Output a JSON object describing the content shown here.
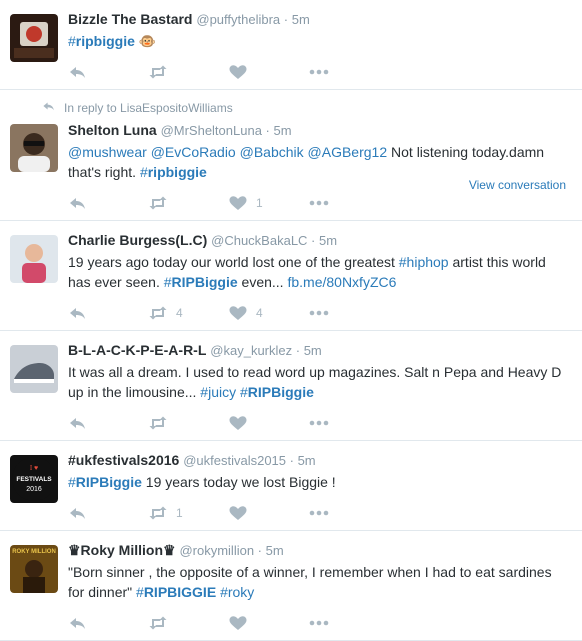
{
  "tweets": [
    {
      "name": "Bizzle The Bastard",
      "handle": "@puffythelibra",
      "time": "5m",
      "segments": [
        {
          "type": "hashtag",
          "hash": "#",
          "tag": "ripbiggie"
        },
        {
          "type": "text",
          "text": " 🐵"
        }
      ],
      "retweets": "",
      "likes": "",
      "avatar": {
        "bg": "#2b1a12",
        "accent": "#c0392b"
      }
    },
    {
      "reply_context": "In reply to LisaEspositoWilliams",
      "name": "Shelton Luna",
      "handle": "@MrSheltonLuna",
      "time": "5m",
      "segments": [
        {
          "type": "link",
          "text": "@mushwear"
        },
        {
          "type": "text",
          "text": " "
        },
        {
          "type": "link",
          "text": "@EvCoRadio"
        },
        {
          "type": "text",
          "text": " "
        },
        {
          "type": "link",
          "text": "@Babchik"
        },
        {
          "type": "text",
          "text": " "
        },
        {
          "type": "link",
          "text": "@AGBerg12"
        },
        {
          "type": "text",
          "text": " Not listening today.damn that's right.  "
        },
        {
          "type": "hashtag",
          "hash": "#",
          "tag": "ripbiggie"
        }
      ],
      "retweets": "",
      "likes": "1",
      "view_conversation": "View conversation",
      "avatar": {
        "bg": "#8a7560",
        "accent": "#3a2a1e"
      }
    },
    {
      "name": "Charlie Burgess(L.C)",
      "handle": "@ChuckBakaLC",
      "time": "5m",
      "segments": [
        {
          "type": "text",
          "text": "19 years ago today our world lost one of the greatest "
        },
        {
          "type": "link",
          "text": "#hiphop"
        },
        {
          "type": "text",
          "text": " artist this world has ever seen.  "
        },
        {
          "type": "hashtag",
          "hash": "#",
          "tag": "RIPBiggie"
        },
        {
          "type": "text",
          "text": " even... "
        },
        {
          "type": "link",
          "text": "fb.me/80NxfyZC6"
        }
      ],
      "retweets": "4",
      "likes": "4",
      "avatar": {
        "bg": "#dfe6ec",
        "accent": "#d24a6a"
      }
    },
    {
      "name": "B-L-A-C-K-P-E-A-R-L",
      "handle": "@kay_kurklez",
      "time": "5m",
      "segments": [
        {
          "type": "text",
          "text": "It was all a dream. I used to read word up magazines. Salt n Pepa and Heavy D up in the limousine... "
        },
        {
          "type": "link",
          "text": "#juicy"
        },
        {
          "type": "text",
          "text": " "
        },
        {
          "type": "hashtag",
          "hash": "#",
          "tag": "RIPBiggie"
        }
      ],
      "retweets": "",
      "likes": "",
      "avatar": {
        "bg": "#c9cfd6",
        "accent": "#5b6470"
      }
    },
    {
      "name": "#ukfestivals2016",
      "handle": "@ukfestivals2015",
      "time": "5m",
      "segments": [
        {
          "type": "hashtag",
          "hash": "#",
          "tag": "RIPBiggie"
        },
        {
          "type": "text",
          "text": " 19 years today we lost Biggie  !"
        }
      ],
      "retweets": "1",
      "likes": "",
      "avatar": {
        "bg": "#111111",
        "accent": "#ffffff",
        "line1": "I ♥",
        "line2": "FESTIVALS",
        "line3": "2016"
      }
    },
    {
      "name": "♛Roky Million♛",
      "handle": "@rokymillion",
      "time": "5m",
      "segments": [
        {
          "type": "text",
          "text": "\"Born sinner , the opposite of a winner, I remember when I had to eat sardines for dinner\" "
        },
        {
          "type": "hashtag",
          "hash": "#",
          "tag": "RIPBIGGIE"
        },
        {
          "type": "text",
          "text": " "
        },
        {
          "type": "link",
          "text": "#roky"
        }
      ],
      "retweets": "",
      "likes": "",
      "avatar": {
        "bg": "#6b4a14",
        "accent": "#e8c24a",
        "line1": "ROKY MILLION"
      }
    }
  ],
  "colors": {
    "link": "#2b7bb9",
    "meta": "#8899a6",
    "icon": "#aab8c2"
  },
  "icons": {
    "reply": "reply-icon",
    "retweet": "retweet-icon",
    "like": "heart-icon",
    "more": "more-icon"
  }
}
